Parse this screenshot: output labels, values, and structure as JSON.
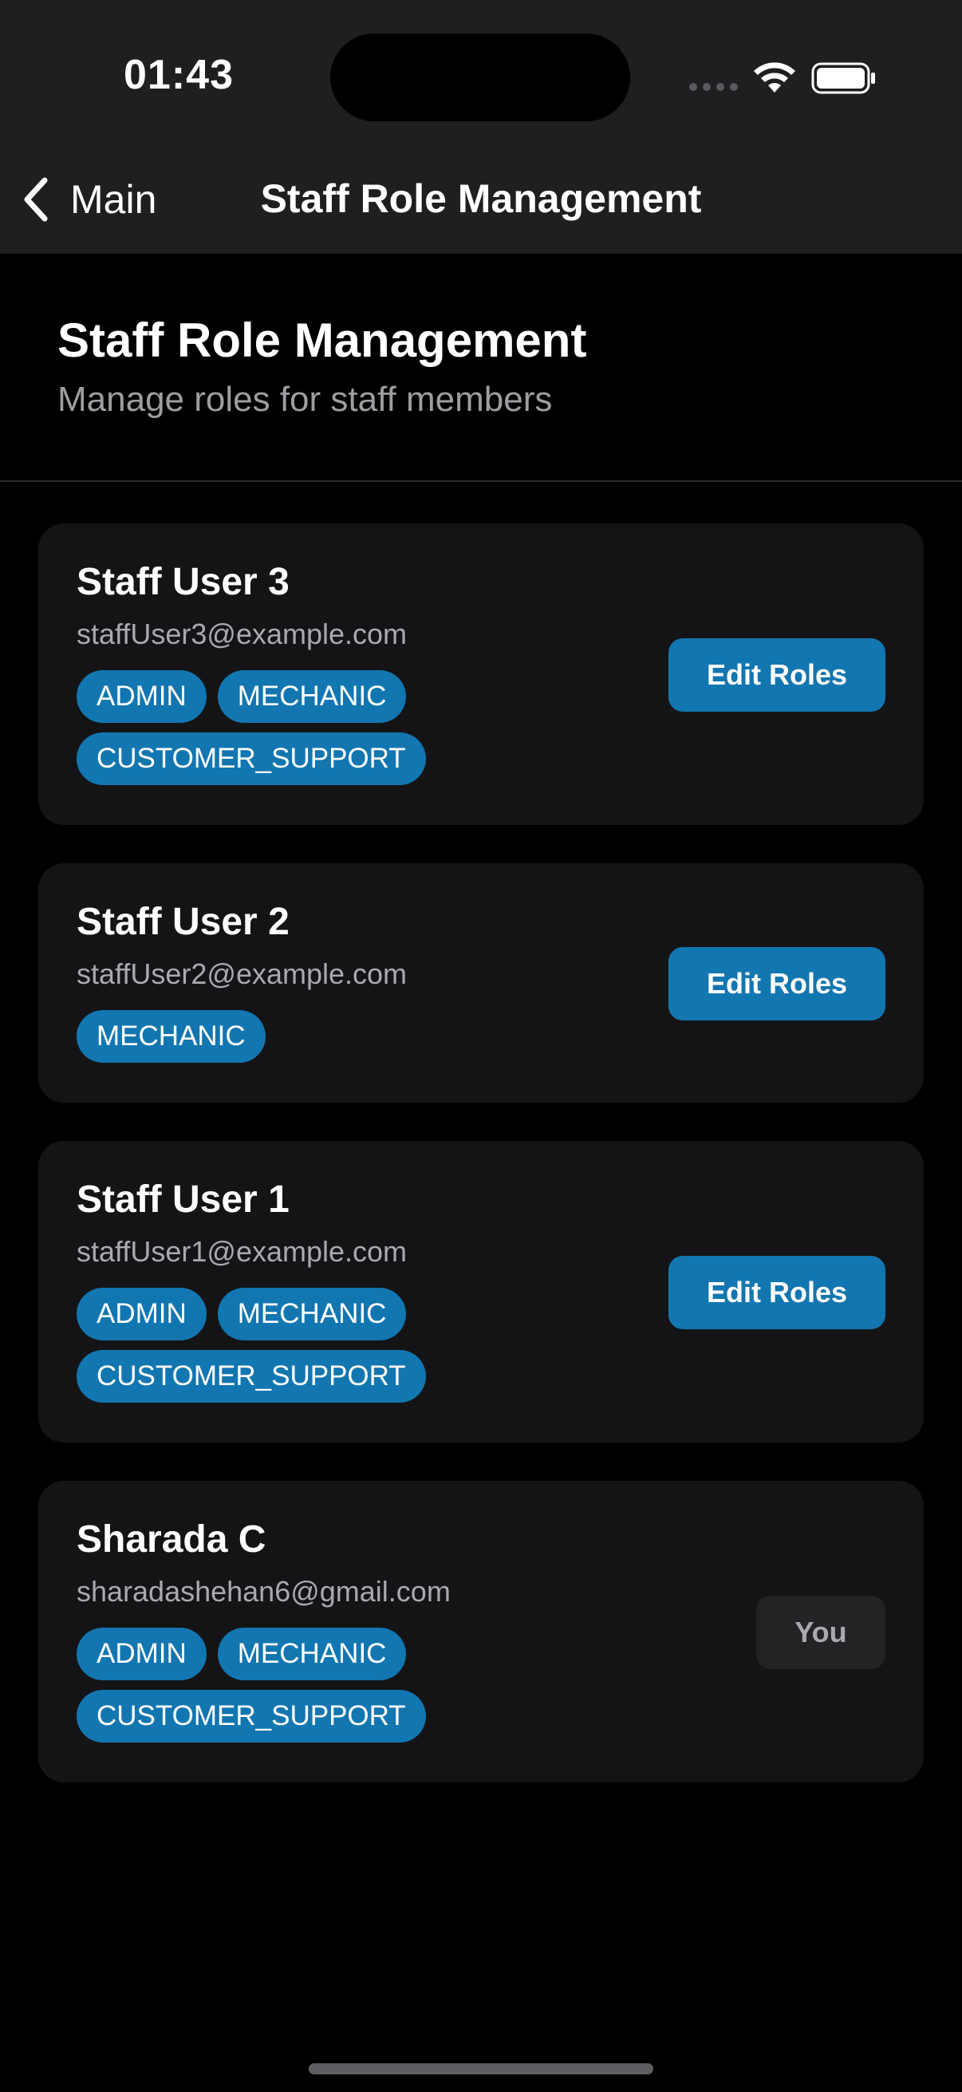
{
  "status_bar": {
    "time": "01:43"
  },
  "nav": {
    "back_label": "Main",
    "title": "Staff Role Management"
  },
  "header": {
    "title": "Staff Role Management",
    "subtitle": "Manage roles for staff members"
  },
  "staff": [
    {
      "name": "Staff User 3",
      "email": "staffUser3@example.com",
      "roles": [
        "ADMIN",
        "MECHANIC",
        "CUSTOMER_SUPPORT"
      ],
      "action_label": "Edit Roles"
    },
    {
      "name": "Staff User 2",
      "email": "staffUser2@example.com",
      "roles": [
        "MECHANIC"
      ],
      "action_label": "Edit Roles"
    },
    {
      "name": "Staff User 1",
      "email": "staffUser1@example.com",
      "roles": [
        "ADMIN",
        "MECHANIC",
        "CUSTOMER_SUPPORT"
      ],
      "action_label": "Edit Roles"
    },
    {
      "name": "Sharada C",
      "email": "sharadashehan6@gmail.com",
      "roles": [
        "ADMIN",
        "MECHANIC",
        "CUSTOMER_SUPPORT"
      ],
      "badge_label": "You"
    }
  ],
  "colors": {
    "accent": "#1276b0",
    "background": "#000000",
    "card": "#141416",
    "chrome": "#1f1f21"
  },
  "icons": {
    "back": "chevron-left-icon",
    "wifi": "wifi-icon",
    "battery": "battery-icon"
  }
}
